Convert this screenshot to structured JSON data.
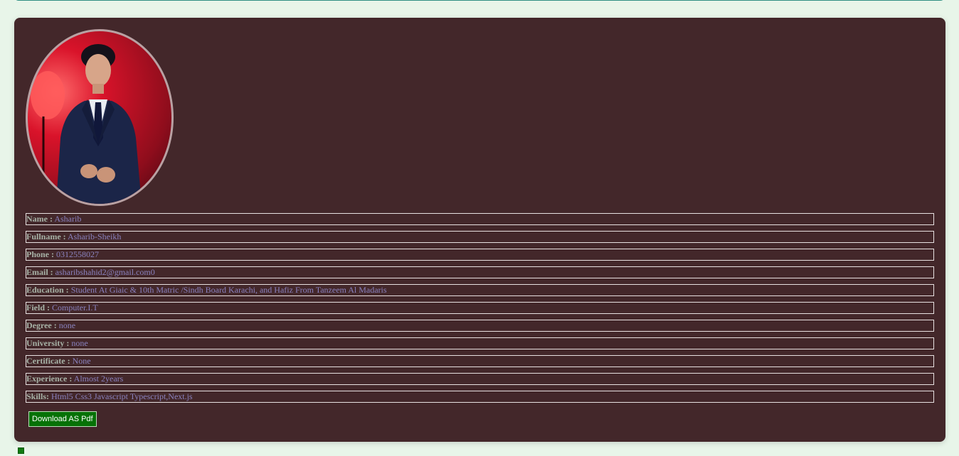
{
  "profile": {
    "rows": [
      {
        "label": "Name :",
        "value": "Asharib"
      },
      {
        "label": "Fullname :",
        "value": "Asharib-Sheikh"
      },
      {
        "label": "Phone :",
        "value": "0312558027"
      },
      {
        "label": "Email :",
        "value": "asharibshahid2@gmail.com0"
      },
      {
        "label": "Education :",
        "value": "Student At Giaic & 10th Matric /Sindh Board Karachi, and Hafiz From Tanzeem Al Madaris"
      },
      {
        "label": "Field :",
        "value": "Computer.I.T"
      },
      {
        "label": "Degree :",
        "value": "none"
      },
      {
        "label": "University :",
        "value": "none"
      },
      {
        "label": "Certificate :",
        "value": "None"
      },
      {
        "label": "Experience :",
        "value": "Almost 2years"
      },
      {
        "label": "Skills:",
        "value": "Html5 Css3 Javascript Typescript,Next.js"
      }
    ],
    "download_label": "Download AS Pdf"
  },
  "colors": {
    "page_bg": "#e8f5e9",
    "card_bg": "#43272a",
    "label": "#a7b2a6",
    "value": "#8a82bf",
    "button_bg": "#067206"
  },
  "icons": {
    "photo": "profile-photo",
    "marker": "green-square-icon"
  }
}
